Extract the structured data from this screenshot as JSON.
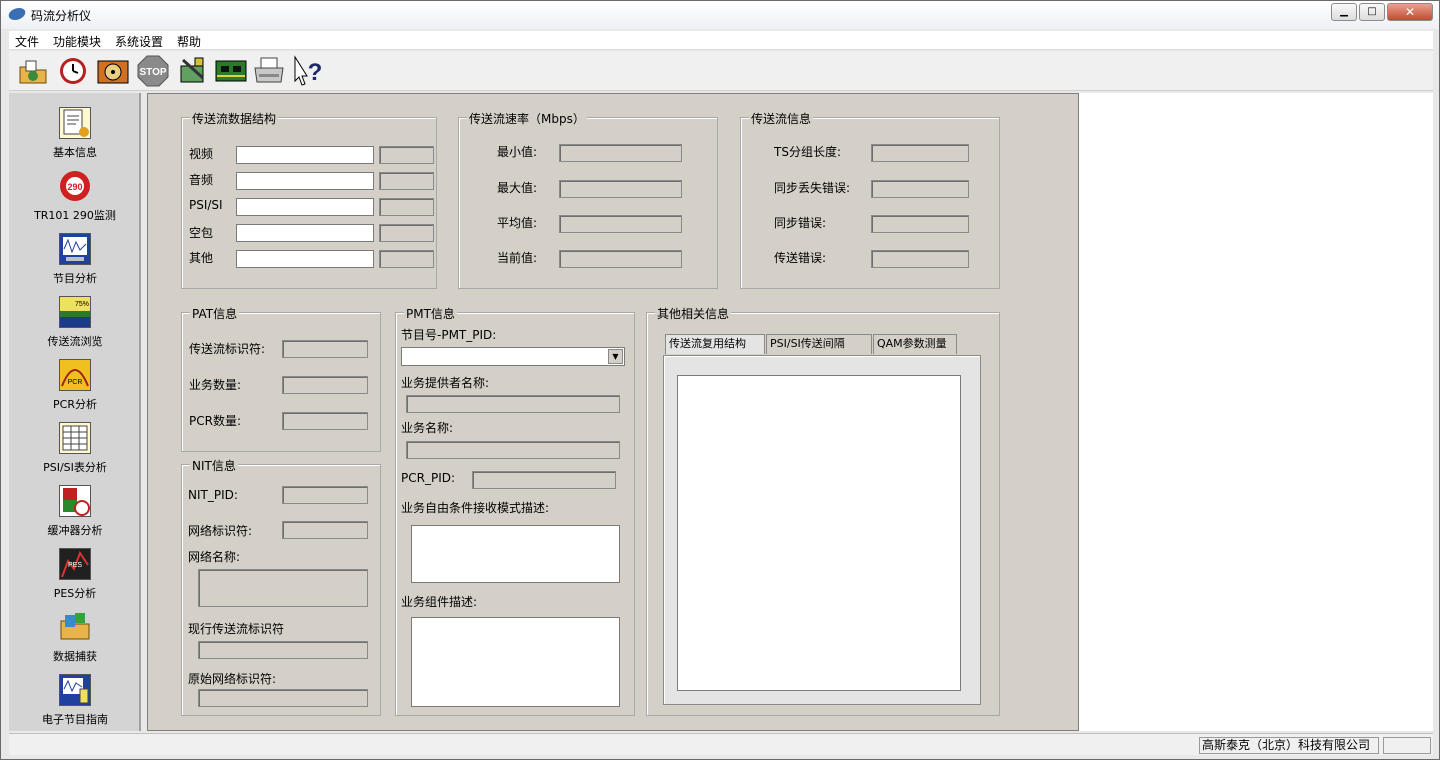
{
  "window": {
    "title": "码流分析仪",
    "min": "▁",
    "max": "□",
    "close": "✕"
  },
  "menu": [
    "文件",
    "功能模块",
    "系统设置",
    "帮助"
  ],
  "toolbar": [
    {
      "name": "open-folder-icon"
    },
    {
      "name": "clock-icon"
    },
    {
      "name": "disk-icon"
    },
    {
      "name": "stop-icon",
      "label": "STOP"
    },
    {
      "name": "tools-icon"
    },
    {
      "name": "circuit-board-icon"
    },
    {
      "name": "printer-icon"
    },
    {
      "name": "help-icon",
      "label": "?"
    }
  ],
  "sidebar": [
    {
      "label": "基本信息",
      "icon": "document-icon"
    },
    {
      "label": "TR101 290监测",
      "icon": "tr101-290-icon"
    },
    {
      "label": "节目分析",
      "icon": "waveform-monitor-icon"
    },
    {
      "label": "传送流浏览",
      "icon": "stream-browse-icon"
    },
    {
      "label": "PCR分析",
      "icon": "pcr-curve-icon"
    },
    {
      "label": "PSI/SI表分析",
      "icon": "table-icon"
    },
    {
      "label": "缓冲器分析",
      "icon": "buffer-icon"
    },
    {
      "label": "PES分析",
      "icon": "pes-chart-icon"
    },
    {
      "label": "数据捕获",
      "icon": "data-capture-icon"
    },
    {
      "label": "电子节目指南",
      "icon": "epg-icon"
    }
  ],
  "ts_structure": {
    "title": "传送流数据结构",
    "rows": [
      "视频",
      "音频",
      "PSI/SI",
      "空包",
      "其他"
    ]
  },
  "ts_rate": {
    "title": "传送流速率（Mbps）",
    "rows": [
      "最小值:",
      "最大值:",
      "平均值:",
      "当前值:"
    ]
  },
  "ts_info": {
    "title": "传送流信息",
    "rows": [
      "TS分组长度:",
      "同步丢失错误:",
      "同步错误:",
      "传送错误:"
    ]
  },
  "pat": {
    "title": "PAT信息",
    "rows": [
      "传送流标识符:",
      "业务数量:",
      "PCR数量:"
    ]
  },
  "nit": {
    "title": "NIT信息",
    "nit_pid": "NIT_PID:",
    "net_id": "网络标识符:",
    "net_name": "网络名称:",
    "cur_ts_id": "现行传送流标识符",
    "orig_net_id": "原始网络标识符:"
  },
  "pmt": {
    "title": "PMT信息",
    "program_pid": "节目号-PMT_PID:",
    "provider": "业务提供者名称:",
    "service_name": "业务名称:",
    "pcr_pid": "PCR_PID:",
    "ca_desc": "业务自由条件接收模式描述:",
    "component_desc": "业务组件描述:"
  },
  "other": {
    "title": "其他相关信息",
    "tabs": [
      "传送流复用结构",
      "PSI/SI传送间隔",
      "QAM参数测量"
    ]
  },
  "status": {
    "company": "高斯泰克（北京）科技有限公司"
  }
}
